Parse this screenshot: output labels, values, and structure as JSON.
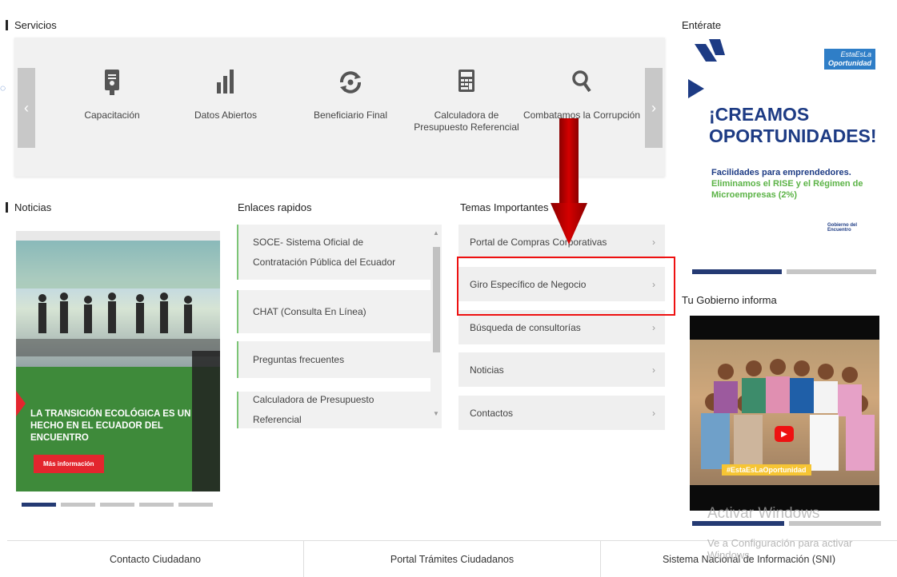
{
  "sections": {
    "servicios": "Servicios",
    "enterate": "Entérate",
    "noticias": "Noticias",
    "enlaces": "Enlaces rapidos",
    "temas": "Temas Importantes",
    "gobierno": "Tu Gobierno informa"
  },
  "services": {
    "prev": "‹",
    "next": "›",
    "items": [
      {
        "label": "Capacitación",
        "icon": "document-certificate-icon"
      },
      {
        "label": "Datos Abiertos",
        "icon": "bar-chart-icon"
      },
      {
        "label": "Beneficiario Final",
        "icon": "sync-target-icon"
      },
      {
        "label": "Calculadora de Presupuesto Referencial",
        "icon": "calculator-icon"
      },
      {
        "label": "Combatamos la Corrupción",
        "icon": "search-icon"
      }
    ]
  },
  "news": {
    "caption": "LA TRANSICIÓN ECOLÓGICA ES UN HECHO EN EL ECUADOR DEL ENCUENTRO",
    "button": "Más información",
    "dots": 5
  },
  "links": {
    "items": [
      {
        "label": "SOCE- Sistema Oficial de Contratación Pública del Ecuador"
      },
      {
        "label": "CHAT (Consulta En Línea)"
      },
      {
        "label": "Preguntas frecuentes"
      },
      {
        "label": "Calculadora de Presupuesto Referencial"
      }
    ]
  },
  "temas": {
    "chevron": "›",
    "items": [
      {
        "label": "Portal de Compras Corporativas"
      },
      {
        "label": "Giro Específico de Negocio"
      },
      {
        "label": "Búsqueda de consultorías"
      },
      {
        "label": "Noticias"
      },
      {
        "label": "Contactos"
      }
    ]
  },
  "banner": {
    "badge1": "EstaEsLa",
    "badge2": "Oportunidad",
    "title1": "¡CREAMOS",
    "title2": "OPORTUNIDADES!",
    "text1": "Facilidades para emprendedores.",
    "text2": "Eliminamos el RISE y el Régimen de Microempresas (2%)",
    "logo": "Gobierno del Encuentro"
  },
  "video": {
    "hashtag": "#EstaEsLaOportunidad"
  },
  "watermark": {
    "line1": "Activar Windows",
    "line2": "Ve a Configuración para activar Windows."
  },
  "footer": {
    "items": [
      "Contacto Ciudadano",
      "Portal Trámites Ciudadanos",
      "Sistema Nacional de Información (SNI)"
    ]
  },
  "colors": {
    "accent_red": "#e11111",
    "navy": "#243a73",
    "green": "#7cc576"
  }
}
